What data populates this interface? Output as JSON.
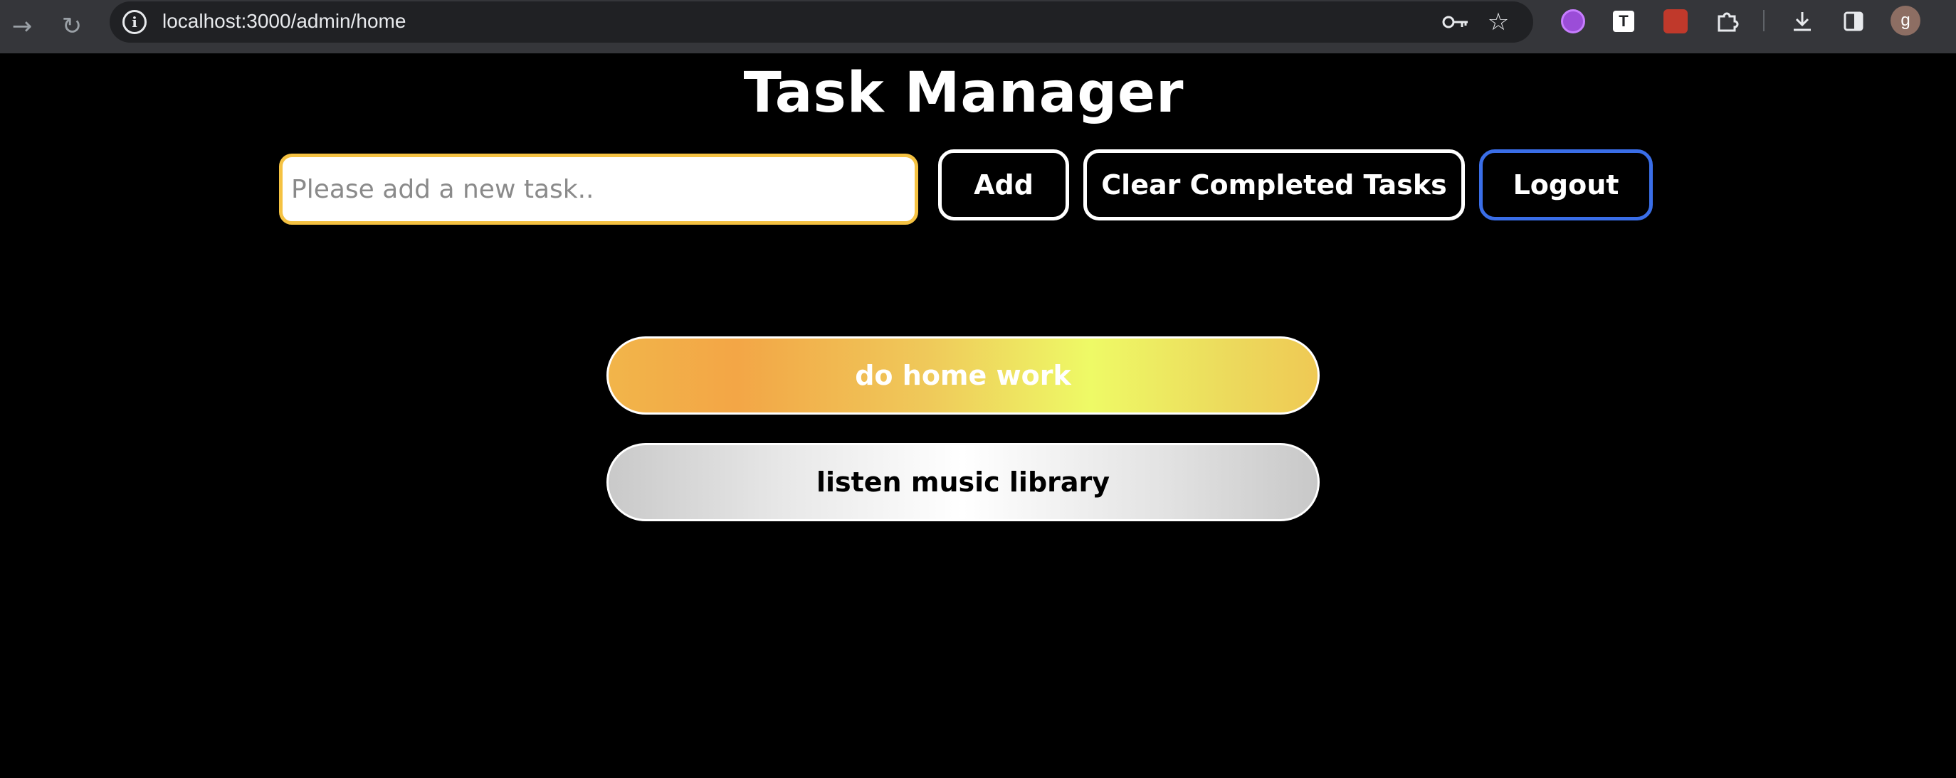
{
  "browser": {
    "url": "localhost:3000/admin/home",
    "forward_icon": "arrow-right-icon",
    "reload_icon": "reload-icon",
    "extension_badge": "T",
    "avatar_initial": "g"
  },
  "page": {
    "title": "Task Manager",
    "input_placeholder": "Please add a new task..",
    "input_value": "",
    "buttons": {
      "add": "Add",
      "clear": "Clear Completed Tasks",
      "logout": "Logout"
    },
    "tasks": [
      {
        "text": "do home work",
        "status": "completed",
        "color": "#f2b54a"
      },
      {
        "text": "listen music library",
        "status": "pending",
        "color": "#e8e8e8"
      }
    ]
  },
  "colors": {
    "background": "#000000",
    "input_border": "#f5c242",
    "logout_border": "#3a6ee8"
  }
}
